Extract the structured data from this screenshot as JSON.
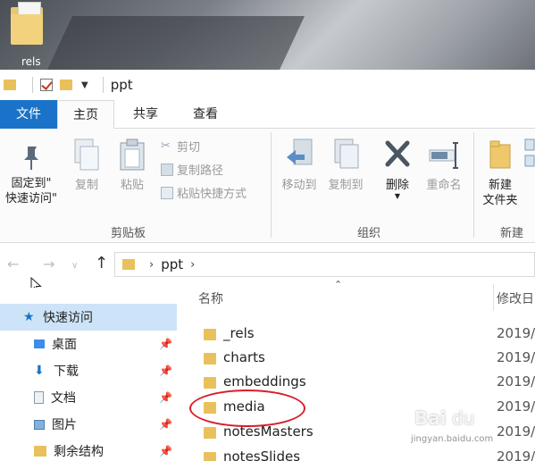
{
  "desktop": {
    "icon_label": "rels"
  },
  "titlebar": {
    "title": "ppt"
  },
  "tabs": {
    "file": "文件",
    "home": "主页",
    "share": "共享",
    "view": "查看"
  },
  "ribbon": {
    "clipboard": {
      "pin_line1": "固定到\"",
      "pin_line2": "快速访问\"",
      "copy": "复制",
      "paste": "粘贴",
      "cut": "剪切",
      "copy_path": "复制路径",
      "paste_shortcut": "粘贴快捷方式",
      "group_label": "剪贴板"
    },
    "organize": {
      "move_to": "移动到",
      "copy_to": "复制到",
      "delete": "删除",
      "rename": "重命名",
      "group_label": "组织"
    },
    "new": {
      "new_folder_line1": "新建",
      "new_folder_line2": "文件夹",
      "group_label": "新建"
    }
  },
  "address": {
    "segment": "ppt"
  },
  "nav": {
    "items": [
      {
        "label": "快速访问"
      },
      {
        "label": "桌面"
      },
      {
        "label": "下载"
      },
      {
        "label": "文档"
      },
      {
        "label": "图片"
      },
      {
        "label": "剩余结构"
      }
    ]
  },
  "filelist": {
    "header_name": "名称",
    "header_date": "修改日",
    "rows": [
      {
        "name": "_rels",
        "date": "2019/"
      },
      {
        "name": "charts",
        "date": "2019/"
      },
      {
        "name": "embeddings",
        "date": "2019/"
      },
      {
        "name": "media",
        "date": "2019/"
      },
      {
        "name": "notesMasters",
        "date": "2019/"
      },
      {
        "name": "notesSlides",
        "date": "2019/"
      }
    ]
  },
  "watermark": {
    "main": "Bai",
    "paw": "du",
    "sub": "jingyan.baidu.com"
  },
  "colors": {
    "file_tab": "#1a73c8",
    "selection": "#cde3f7",
    "folder": "#e8c15c",
    "annotation": "#d81e2a"
  }
}
